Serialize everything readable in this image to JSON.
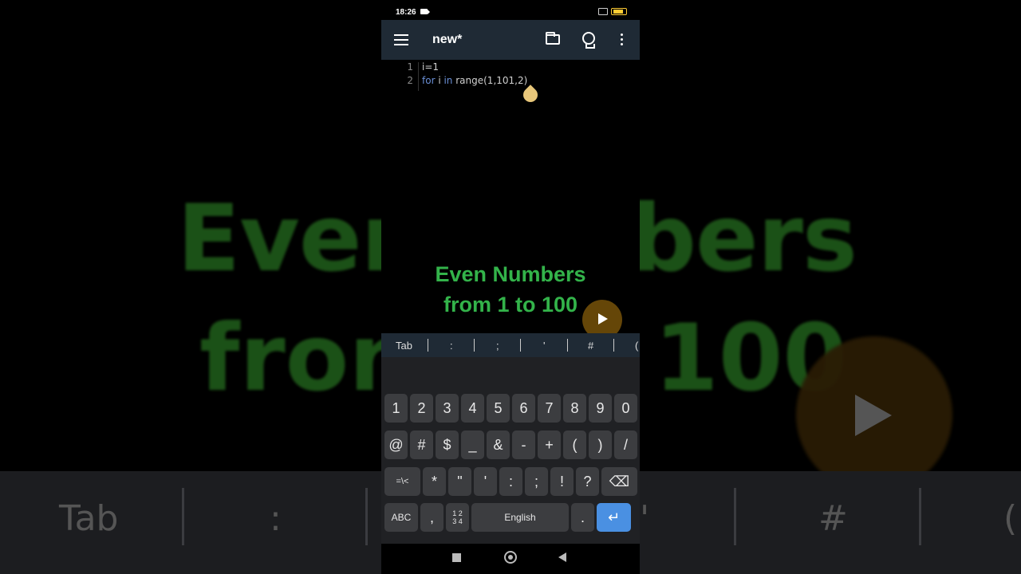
{
  "status": {
    "time": "18:26"
  },
  "app": {
    "title": "new*"
  },
  "editor": {
    "lines": [
      {
        "num": "1",
        "parts": [
          {
            "t": "i=1",
            "kw": false
          }
        ]
      },
      {
        "num": "2",
        "parts": [
          {
            "t": "for",
            "kw": true
          },
          {
            "t": " i ",
            "kw": false
          },
          {
            "t": "in",
            "kw": true
          },
          {
            "t": " range(1,101,2)",
            "kw": false
          }
        ]
      }
    ]
  },
  "overlay": {
    "line1": "Even Numbers",
    "line2": "from 1 to 100"
  },
  "symbols": [
    "Tab",
    ":",
    ";",
    "'",
    "#",
    "("
  ],
  "keyboard": {
    "row1": [
      "1",
      "2",
      "3",
      "4",
      "5",
      "6",
      "7",
      "8",
      "9",
      "0"
    ],
    "row2": [
      "@",
      "#",
      "$",
      "_",
      "&",
      "-",
      "+",
      "(",
      ")",
      "/"
    ],
    "row3": [
      "=\\<",
      "*",
      "\"",
      "'",
      ":",
      ";",
      "!",
      "?",
      "⌫"
    ],
    "row4": {
      "abc": "ABC",
      "comma": ",",
      "numpad": "1 2\n3 4",
      "space": "English",
      "period": ".",
      "enter": "↵"
    }
  },
  "background": {
    "line1a": "Even",
    "line1b": "bers",
    "line2a": "fron",
    "line2b": "100",
    "keys": [
      "Tab",
      ":",
      "'",
      "#",
      "("
    ]
  },
  "colors": {
    "accent_green": "#33b34a",
    "appbar": "#1f2a35",
    "enter_key": "#4a90e2"
  }
}
